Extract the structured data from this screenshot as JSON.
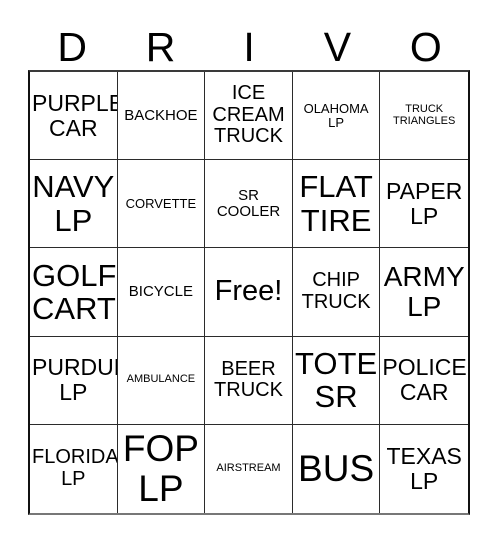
{
  "card": {
    "title_letters": [
      "D",
      "R",
      "I",
      "V",
      "O"
    ],
    "grid_size": "5x5",
    "free_space_label": "Free!",
    "columns": [
      {
        "letter": "D",
        "cells": [
          {
            "label": "PURPLE\nCAR",
            "size": "md",
            "marked": false
          },
          {
            "label": "NAVY\nLP",
            "size": "xl",
            "marked": false
          },
          {
            "label": "GOLF\nCART",
            "size": "xl",
            "marked": false
          },
          {
            "label": "PURDUE\nLP",
            "size": "md",
            "marked": false
          },
          {
            "label": "FLORIDA\nLP",
            "size": "sm",
            "marked": false
          }
        ]
      },
      {
        "letter": "R",
        "cells": [
          {
            "label": "BACKHOE",
            "size": "xs",
            "marked": false
          },
          {
            "label": "CORVETTE",
            "size": "xxs",
            "marked": false
          },
          {
            "label": "BICYCLE",
            "size": "xs",
            "marked": false
          },
          {
            "label": "AMBULANCE",
            "size": "tiny",
            "marked": false
          },
          {
            "label": "FOP\nLP",
            "size": "xxl",
            "marked": false
          }
        ]
      },
      {
        "letter": "I",
        "cells": [
          {
            "label": "ICE\nCREAM\nTRUCK",
            "size": "sm",
            "marked": false
          },
          {
            "label": "SR\nCOOLER",
            "size": "xs",
            "marked": false
          },
          {
            "label": "Free!",
            "size": "free",
            "marked": false
          },
          {
            "label": "BEER\nTRUCK",
            "size": "sm",
            "marked": false
          },
          {
            "label": "AIRSTREAM",
            "size": "tiny",
            "marked": false
          }
        ]
      },
      {
        "letter": "V",
        "cells": [
          {
            "label": "OLAHOMA\nLP",
            "size": "xxs",
            "marked": false
          },
          {
            "label": "FLAT\nTIRE",
            "size": "xl",
            "marked": false
          },
          {
            "label": "CHIP\nTRUCK",
            "size": "sm",
            "marked": false
          },
          {
            "label": "TOTE\nSR",
            "size": "xl",
            "marked": false
          },
          {
            "label": "BUS",
            "size": "xxl",
            "marked": false
          }
        ]
      },
      {
        "letter": "O",
        "cells": [
          {
            "label": "TRUCK\nTRIANGLES",
            "size": "tiny",
            "marked": false
          },
          {
            "label": "PAPER\nLP",
            "size": "md",
            "marked": false
          },
          {
            "label": "ARMY\nLP",
            "size": "lg",
            "marked": false
          },
          {
            "label": "POLICE\nCAR",
            "size": "md",
            "marked": false
          },
          {
            "label": "TEXAS\nLP",
            "size": "md",
            "marked": false
          }
        ]
      }
    ]
  },
  "colors": {
    "background": "#ffffff",
    "text": "#000000",
    "grid_line": "#2b2b2b",
    "grid_outer": "#111111"
  }
}
